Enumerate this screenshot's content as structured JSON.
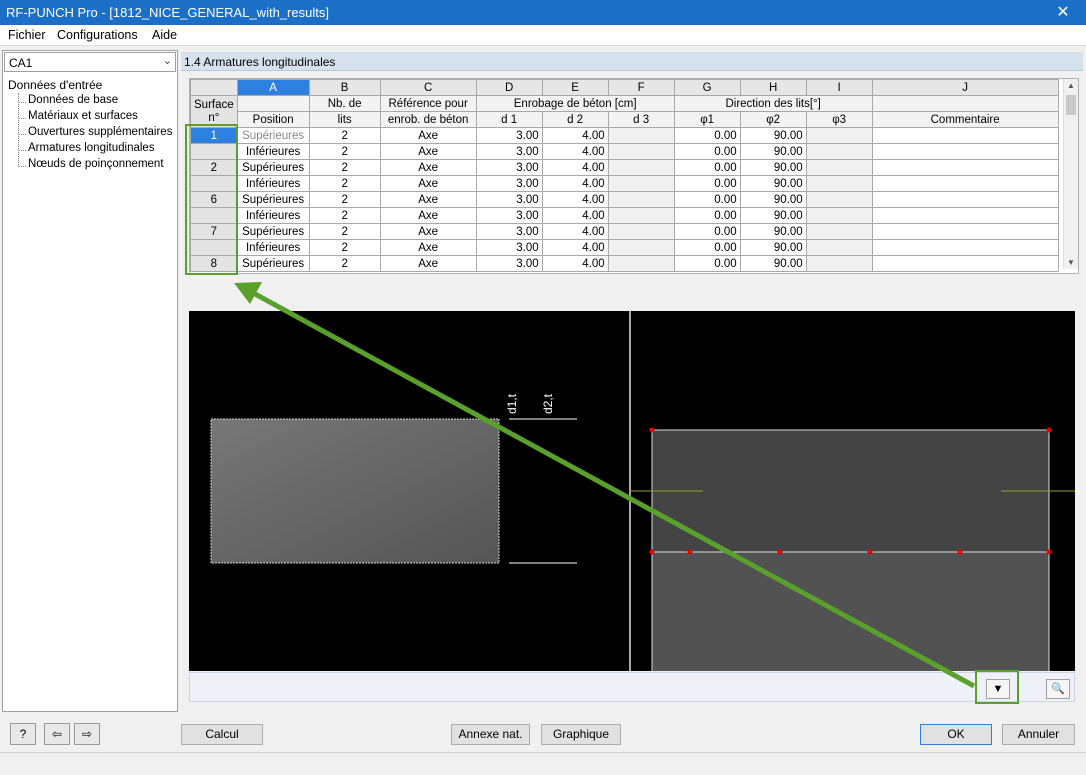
{
  "window": {
    "title": "RF-PUNCH Pro - [1812_NICE_GENERAL_with_results]",
    "close_glyph": "✕"
  },
  "menu": {
    "file": "Fichier",
    "configurations": "Configurations",
    "help": "Aide"
  },
  "navigator": {
    "case_select": "CA1",
    "root": "Données d'entrée",
    "items": [
      "Données de base",
      "Matériaux et surfaces",
      "Ouvertures supplémentaires",
      "Armatures longitudinales",
      "Nœuds de poinçonnement"
    ]
  },
  "section": {
    "title": "1.4 Armatures longitudinales"
  },
  "table": {
    "col_letters": [
      "A",
      "B",
      "C",
      "D",
      "E",
      "F",
      "G",
      "H",
      "I",
      "J"
    ],
    "hdr": {
      "surface_1": "Surface",
      "surface_2": "n°",
      "position": "Position",
      "nb_1": "Nb. de",
      "nb_2": "lits",
      "ref_1": "Référence pour",
      "ref_2": "enrob. de béton",
      "enrobage": "Enrobage de béton [cm]",
      "direction": "Direction des lits[°]",
      "d1": "d 1",
      "d2": "d 2",
      "d3": "d 3",
      "phi1": "φ1",
      "phi2": "φ2",
      "phi3": "φ3",
      "comment": "Commentaire"
    },
    "rows": [
      {
        "surface": "1",
        "position": "Supérieures",
        "nb": "2",
        "ref": "Axe",
        "d1": "3.00",
        "d2": "4.00",
        "d3": "",
        "phi1": "0.00",
        "phi2": "90.00",
        "phi3": "",
        "comment": ""
      },
      {
        "surface": "",
        "position": "Inférieures",
        "nb": "2",
        "ref": "Axe",
        "d1": "3.00",
        "d2": "4.00",
        "d3": "",
        "phi1": "0.00",
        "phi2": "90.00",
        "phi3": "",
        "comment": ""
      },
      {
        "surface": "2",
        "position": "Supérieures",
        "nb": "2",
        "ref": "Axe",
        "d1": "3.00",
        "d2": "4.00",
        "d3": "",
        "phi1": "0.00",
        "phi2": "90.00",
        "phi3": "",
        "comment": ""
      },
      {
        "surface": "",
        "position": "Inférieures",
        "nb": "2",
        "ref": "Axe",
        "d1": "3.00",
        "d2": "4.00",
        "d3": "",
        "phi1": "0.00",
        "phi2": "90.00",
        "phi3": "",
        "comment": ""
      },
      {
        "surface": "6",
        "position": "Supérieures",
        "nb": "2",
        "ref": "Axe",
        "d1": "3.00",
        "d2": "4.00",
        "d3": "",
        "phi1": "0.00",
        "phi2": "90.00",
        "phi3": "",
        "comment": ""
      },
      {
        "surface": "",
        "position": "Inférieures",
        "nb": "2",
        "ref": "Axe",
        "d1": "3.00",
        "d2": "4.00",
        "d3": "",
        "phi1": "0.00",
        "phi2": "90.00",
        "phi3": "",
        "comment": ""
      },
      {
        "surface": "7",
        "position": "Supérieures",
        "nb": "2",
        "ref": "Axe",
        "d1": "3.00",
        "d2": "4.00",
        "d3": "",
        "phi1": "0.00",
        "phi2": "90.00",
        "phi3": "",
        "comment": ""
      },
      {
        "surface": "",
        "position": "Inférieures",
        "nb": "2",
        "ref": "Axe",
        "d1": "3.00",
        "d2": "4.00",
        "d3": "",
        "phi1": "0.00",
        "phi2": "90.00",
        "phi3": "",
        "comment": ""
      },
      {
        "surface": "8",
        "position": "Supérieures",
        "nb": "2",
        "ref": "Axe",
        "d1": "3.00",
        "d2": "4.00",
        "d3": "",
        "phi1": "0.00",
        "phi2": "90.00",
        "phi3": "",
        "comment": ""
      }
    ]
  },
  "graphic": {
    "label_d1": "d1,t",
    "label_d2": "d2,t"
  },
  "graphic_toolbar": {
    "filter_icon": "filter-icon",
    "zoom_icon": "zoom-reset-icon"
  },
  "buttons": {
    "calcul": "Calcul",
    "annexe": "Annexe nat.",
    "graphique": "Graphique",
    "ok": "OK",
    "annuler": "Annuler"
  },
  "colors": {
    "titlebar": "#1c6fc6",
    "selection": "#2d7fe0",
    "annotation_green": "#5aa02c",
    "graphic_bg": "#000000"
  }
}
